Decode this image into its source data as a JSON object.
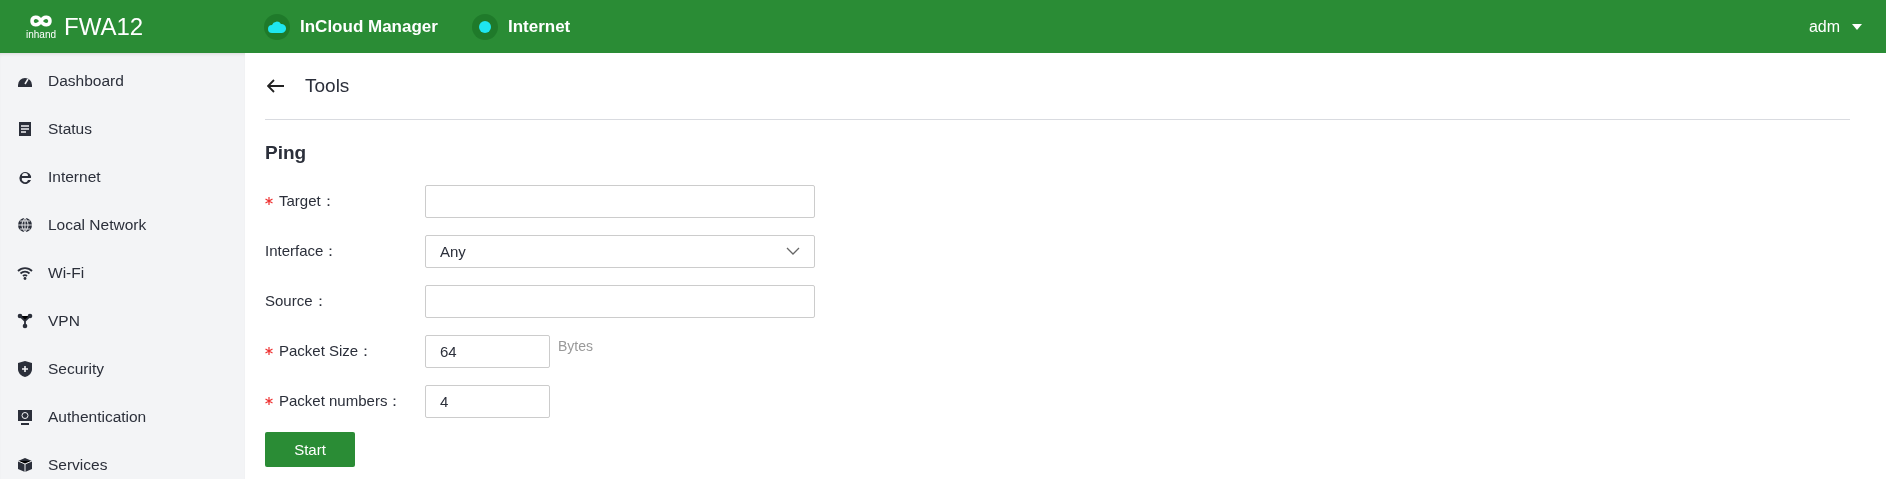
{
  "header": {
    "product": "FWA12",
    "logo_text": "inhand",
    "links": [
      {
        "label": "InCloud Manager"
      },
      {
        "label": "Internet"
      }
    ],
    "user": "adm"
  },
  "sidebar": {
    "items": [
      {
        "label": "Dashboard"
      },
      {
        "label": "Status"
      },
      {
        "label": "Internet"
      },
      {
        "label": "Local Network"
      },
      {
        "label": "Wi-Fi"
      },
      {
        "label": "VPN"
      },
      {
        "label": "Security"
      },
      {
        "label": "Authentication"
      },
      {
        "label": "Services"
      }
    ]
  },
  "page": {
    "title": "Tools",
    "section": "Ping",
    "fields": [
      {
        "kind": "text",
        "label": "Target：",
        "required": true
      },
      {
        "kind": "select",
        "label": "Interface：",
        "required": false,
        "value": "Any"
      },
      {
        "kind": "text",
        "label": "Source：",
        "required": false
      },
      {
        "kind": "short",
        "label": "Packet Size：",
        "required": true,
        "value": "64",
        "suffix": "Bytes"
      },
      {
        "kind": "short",
        "label": "Packet numbers：",
        "required": true,
        "value": "4"
      }
    ],
    "button": "Start"
  }
}
